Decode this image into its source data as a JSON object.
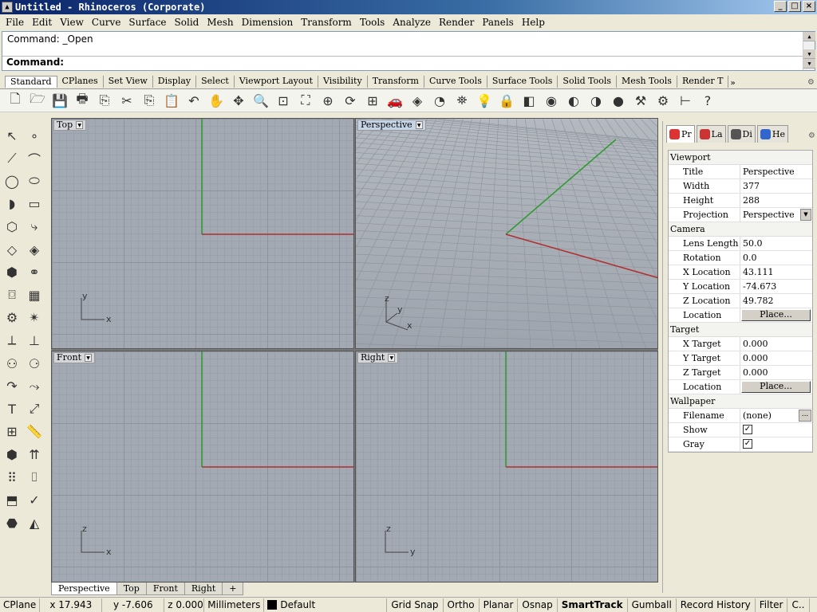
{
  "window": {
    "title": "Untitled - Rhinoceros (Corporate)",
    "min": "_",
    "max": "□",
    "close": "×"
  },
  "menu": [
    "File",
    "Edit",
    "View",
    "Curve",
    "Surface",
    "Solid",
    "Mesh",
    "Dimension",
    "Transform",
    "Tools",
    "Analyze",
    "Render",
    "Panels",
    "Help"
  ],
  "command": {
    "history": "Command: _Open",
    "prompt": "Command:"
  },
  "toolbar_tabs": [
    "Standard",
    "CPlanes",
    "Set View",
    "Display",
    "Select",
    "Viewport Layout",
    "Visibility",
    "Transform",
    "Curve Tools",
    "Surface Tools",
    "Solid Tools",
    "Mesh Tools",
    "Render T"
  ],
  "toolbar_more": "»",
  "toolbar_icons": [
    "new-file",
    "open-folder",
    "save",
    "print",
    "import",
    "cut",
    "copy",
    "paste",
    "undo",
    "pan",
    "rotate-view",
    "zoom",
    "zoom-window",
    "zoom-extents",
    "zoom-selected",
    "rotate",
    "four-viewports",
    "car-display",
    "ghosted",
    "rendered-mode",
    "object-snap",
    "light-bulb",
    "lock",
    "layer",
    "color-wheel",
    "material-sphere",
    "environment-sphere",
    "blue-sphere",
    "hammer",
    "settings-gear",
    "dimension",
    "help"
  ],
  "toolbar_glyphs": [
    "🗋",
    "🗁",
    "💾",
    "🖶",
    "⎘",
    "✂",
    "⎘",
    "📋",
    "↶",
    "✋",
    "✥",
    "🔍",
    "⊡",
    "⛶",
    "⊕",
    "⟳",
    "⊞",
    "🚗",
    "◈",
    "◔",
    "⛯",
    "💡",
    "🔒",
    "◧",
    "◉",
    "◐",
    "◑",
    "●",
    "⚒",
    "⚙",
    "⊢",
    "?"
  ],
  "left_tools": [
    {
      "name": "select-arrow",
      "g": "↖"
    },
    {
      "name": "point",
      "g": "∘"
    },
    {
      "name": "polyline",
      "g": "⟋"
    },
    {
      "name": "curve-points",
      "g": "⌒"
    },
    {
      "name": "circle",
      "g": "◯"
    },
    {
      "name": "ellipse",
      "g": "⬭"
    },
    {
      "name": "arc",
      "g": "◗"
    },
    {
      "name": "rectangle",
      "g": "▭"
    },
    {
      "name": "polygon",
      "g": "⬡"
    },
    {
      "name": "fillet",
      "g": "⤷"
    },
    {
      "name": "surface-corners",
      "g": "◇"
    },
    {
      "name": "surface-loft",
      "g": "◈"
    },
    {
      "name": "box",
      "g": "⬢"
    },
    {
      "name": "boolean-union",
      "g": "⚭"
    },
    {
      "name": "cylinder",
      "g": "⌼"
    },
    {
      "name": "mesh-surface",
      "g": "▦"
    },
    {
      "name": "gear-tool",
      "g": "⚙"
    },
    {
      "name": "explode",
      "g": "✴"
    },
    {
      "name": "trim",
      "g": "⟂"
    },
    {
      "name": "split",
      "g": "⊥"
    },
    {
      "name": "group",
      "g": "⚇"
    },
    {
      "name": "ungroup",
      "g": "⚆"
    },
    {
      "name": "curve-boolean",
      "g": "↷"
    },
    {
      "name": "blend-curve",
      "g": "⤳"
    },
    {
      "name": "text",
      "g": "T"
    },
    {
      "name": "dimension-tool",
      "g": "⤢"
    },
    {
      "name": "array",
      "g": "⊞"
    },
    {
      "name": "measure",
      "g": "📏"
    },
    {
      "name": "solid-edit",
      "g": "⬢"
    },
    {
      "name": "cage-edit",
      "g": "⇈"
    },
    {
      "name": "grid-array",
      "g": "⠿"
    },
    {
      "name": "analyze",
      "g": "⌷"
    },
    {
      "name": "extrude",
      "g": "⬒"
    },
    {
      "name": "check",
      "g": "✓"
    },
    {
      "name": "solid-tools",
      "g": "⬣"
    },
    {
      "name": "render-tool",
      "g": "◭"
    }
  ],
  "viewports": [
    {
      "label": "Top",
      "axes": [
        "y",
        "x"
      ]
    },
    {
      "label": "Perspective",
      "axes": [
        "z",
        "y",
        "x"
      ]
    },
    {
      "label": "Front",
      "axes": [
        "z",
        "x"
      ]
    },
    {
      "label": "Right",
      "axes": [
        "z",
        "y"
      ]
    }
  ],
  "viewport_tabs": [
    "Perspective",
    "Top",
    "Front",
    "Right"
  ],
  "viewport_tab_add": "+",
  "panel": {
    "tabs": [
      "Pr",
      "La",
      "Di",
      "He"
    ],
    "tab_colors": [
      "#d33",
      "#c33",
      "#555",
      "#3366cc"
    ],
    "gear": "⚙",
    "sections": [
      {
        "title": "Viewport",
        "rows": [
          {
            "key": "Title",
            "value": "Perspective"
          },
          {
            "key": "Width",
            "value": "377"
          },
          {
            "key": "Height",
            "value": "288"
          },
          {
            "key": "Projection",
            "value": "Perspective",
            "dropdown": true
          }
        ]
      },
      {
        "title": "Camera",
        "rows": [
          {
            "key": "Lens Length",
            "value": "50.0"
          },
          {
            "key": "Rotation",
            "value": "0.0"
          },
          {
            "key": "X Location",
            "value": "43.111"
          },
          {
            "key": "Y Location",
            "value": "-74.673"
          },
          {
            "key": "Z Location",
            "value": "49.782"
          },
          {
            "key": "Location",
            "value": "Place...",
            "button": true
          }
        ]
      },
      {
        "title": "Target",
        "rows": [
          {
            "key": "X Target",
            "value": "0.000"
          },
          {
            "key": "Y Target",
            "value": "0.000"
          },
          {
            "key": "Z Target",
            "value": "0.000"
          },
          {
            "key": "Location",
            "value": "Place...",
            "button": true
          }
        ]
      },
      {
        "title": "Wallpaper",
        "rows": [
          {
            "key": "Filename",
            "value": "(none)",
            "more": "..."
          },
          {
            "key": "Show",
            "value": "✓",
            "check": true
          },
          {
            "key": "Gray",
            "value": "✓",
            "check": true
          }
        ]
      }
    ]
  },
  "status": {
    "cplane": "CPlane",
    "x": "x 17.943",
    "y": "y -7.606",
    "z": "z 0.000",
    "units": "Millimeters",
    "layer": "Default",
    "toggles": [
      {
        "label": "Grid Snap",
        "active": false
      },
      {
        "label": "Ortho",
        "active": false
      },
      {
        "label": "Planar",
        "active": false
      },
      {
        "label": "Osnap",
        "active": false
      },
      {
        "label": "SmartTrack",
        "active": true
      },
      {
        "label": "Gumball",
        "active": false
      },
      {
        "label": "Record History",
        "active": false
      },
      {
        "label": "Filter",
        "active": false
      },
      {
        "label": "C..",
        "active": false
      }
    ]
  },
  "colors": {
    "x_axis": "#b03030",
    "y_axis": "#2a9a2a",
    "viewport_bg": "#a2a9b3"
  }
}
